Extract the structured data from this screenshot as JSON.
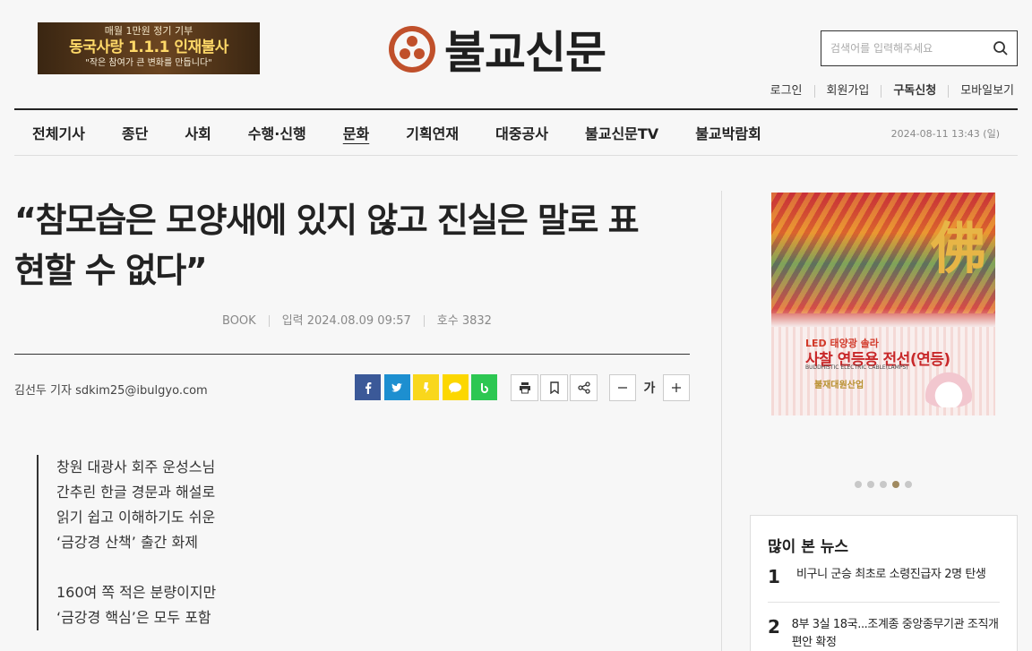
{
  "ad_banner": {
    "line1": "매월 1만원 정기 기부",
    "line2": "동국사랑 1.1.1 인재불사",
    "line3": "\"작은 참여가 큰 변화를 만듭니다\""
  },
  "logo": {
    "text": "불교신문"
  },
  "search": {
    "placeholder": "검색어를 입력해주세요"
  },
  "util_links": [
    "로그인",
    "회원가입",
    "구독신청",
    "모바일보기"
  ],
  "nav": {
    "items": [
      "전체기사",
      "종단",
      "사회",
      "수행·신행",
      "문화",
      "기획연재",
      "대중공사",
      "불교신문TV",
      "불교박람회"
    ],
    "active": "문화",
    "datetime": "2024-08-11 13:43 (일)"
  },
  "article": {
    "headline_line1": "“참모습은 모양새에 있지 않고 진실은 말로 표",
    "headline_line2": "현할 수 없다”",
    "section": "BOOK",
    "input_date": "입력 2024.08.09 09:57",
    "issue": "호수 3832",
    "byline": "김선두 기자 sdkim25@ibulgyo.com",
    "font_label": "가",
    "subheads": [
      "창원 대광사 회주 운성스님",
      "간추린 한글 경문과 해설로",
      "읽기 쉽고 이해하기도 쉬운",
      "‘금강경 산책’ 출간 화제",
      "160여 쪽 적은 분량이지만",
      "‘금강경 핵심’은 모두 포함"
    ]
  },
  "share_icons": [
    {
      "name": "facebook-icon",
      "color": "#3b5998"
    },
    {
      "name": "twitter-icon",
      "color": "#1da1f2"
    },
    {
      "name": "kakaostory-icon",
      "color": "#f9d71c"
    },
    {
      "name": "kakaotalk-icon",
      "color": "#fcd700"
    },
    {
      "name": "band-icon",
      "color": "#2dc752"
    }
  ],
  "side_ad": {
    "hanja": "佛",
    "line1": "LED 태양광 솔라",
    "line2": "사찰 연등용 전선(연등)",
    "line3": "BUDDHISTIC ELECTRIC CABLE(LAMPS)",
    "line4": "불재대원산업"
  },
  "carousel": {
    "count": 5,
    "active_index": 3
  },
  "popular": {
    "title": "많이 본 뉴스",
    "items": [
      {
        "rank": "1",
        "title": "비구니 군승 최초로 소령진급자 2명 탄생"
      },
      {
        "rank": "2",
        "title": "8부 3실 18국...조계종 중앙종무기관 조직개편안 확정"
      }
    ]
  }
}
